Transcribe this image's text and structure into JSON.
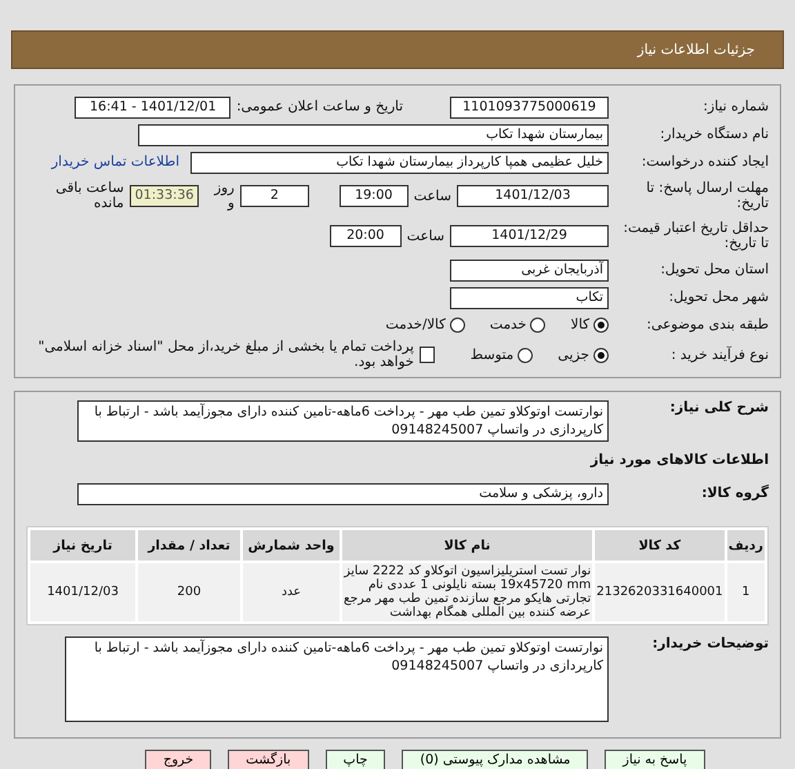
{
  "header": {
    "title": "جزئیات اطلاعات نیاز"
  },
  "need_number": {
    "label": "شماره نیاز:",
    "value": "1101093775000619"
  },
  "announce": {
    "label": "تاریخ و ساعت اعلان عمومی:",
    "value": "1401/12/01 - 16:41"
  },
  "buyer_org": {
    "label": "نام دستگاه خریدار:",
    "value": "بیمارستان شهدا تکاب"
  },
  "creator": {
    "label": "ایجاد کننده درخواست:",
    "value": "خلیل عظیمی همپا کارپرداز بیمارستان شهدا تکاب",
    "link": "اطلاعات تماس خریدار"
  },
  "deadline": {
    "label": "مهلت ارسال پاسخ: تا تاریخ:",
    "date": "1401/12/03",
    "time_label": "ساعت",
    "time": "19:00",
    "days": "2",
    "days_label": "روز و",
    "remaining": "01:33:36",
    "remaining_label": "ساعت باقی مانده"
  },
  "validity": {
    "label": "حداقل تاریخ اعتبار قیمت: تا تاریخ:",
    "date": "1401/12/29",
    "time_label": "ساعت",
    "time": "20:00"
  },
  "province": {
    "label": "استان محل تحویل:",
    "value": "آذربایجان غربی"
  },
  "city": {
    "label": "شهر محل تحویل:",
    "value": "تکاب"
  },
  "category": {
    "label": "طبقه بندی موضوعی:",
    "options": [
      {
        "label": "کالا",
        "selected": true
      },
      {
        "label": "خدمت",
        "selected": false
      },
      {
        "label": "کالا/خدمت",
        "selected": false
      }
    ]
  },
  "purchase_type": {
    "label": "نوع فرآیند خرید :",
    "options": [
      {
        "label": "جزیی",
        "selected": true
      },
      {
        "label": "متوسط",
        "selected": false
      }
    ],
    "treasury": {
      "checked": false,
      "label": "پرداخت تمام یا بخشی از مبلغ خرید،از محل \"اسناد خزانه اسلامی\" خواهد بود."
    }
  },
  "description": {
    "label": "شرح کلی نیاز:",
    "value": "نوارتست اوتوکلاو تمین طب مهر   - پرداخت 6ماهه-تامین کننده دارای مجوزآیمد باشد - ارتباط با کارپردازی در واتساپ 09148245007"
  },
  "goods_heading": "اطلاعات کالاهای مورد نیاز",
  "goods_group": {
    "label": "گروه کالا:",
    "value": "دارو، پزشکی و سلامت"
  },
  "table": {
    "columns": [
      "ردیف",
      "کد کالا",
      "نام کالا",
      "واحد شمارش",
      "تعداد / مقدار",
      "تاریخ نیاز"
    ],
    "rows": [
      [
        "1",
        "2132620331640001",
        "نوار تست استریلیزاسیون اتوکلاو کد 2222 سایز 19x45720 mm بسته نایلونی 1 عددی نام تجارتی هایکو مرجع سازنده تمین طب مهر مرجع عرضه کننده بین المللی همگام بهداشت",
        "عدد",
        "200",
        "1401/12/03"
      ]
    ]
  },
  "buyer_notes": {
    "label": "توضیحات خریدار:",
    "value": "نوارتست اوتوکلاو تمین طب مهر   - پرداخت 6ماهه-تامین کننده دارای مجوزآیمد باشد - ارتباط با کارپردازی در واتساپ 09148245007"
  },
  "buttons": [
    {
      "label": "پاسخ به نیاز",
      "kind": "green"
    },
    {
      "label": "مشاهده مدارک پیوستی (0)",
      "kind": "green"
    },
    {
      "label": "چاپ",
      "kind": "green"
    },
    {
      "label": "بازگشت",
      "kind": "red"
    },
    {
      "label": "خروج",
      "kind": "red"
    }
  ]
}
